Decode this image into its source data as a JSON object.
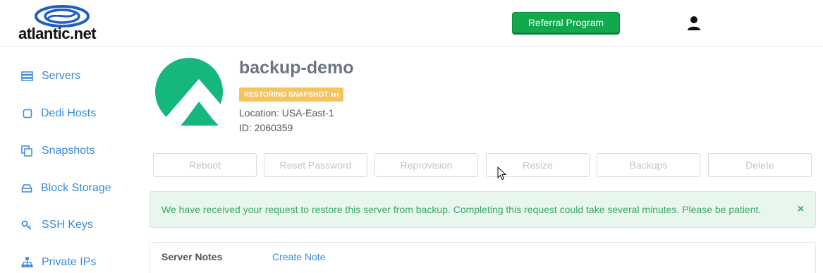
{
  "header": {
    "logo_text": "atlantic.net",
    "referral_label": "Referral Program",
    "colors": {
      "referral": "#10a94b",
      "logo_blue": "#1f5fbf"
    }
  },
  "sidebar": {
    "items": [
      {
        "label": "Servers",
        "icon": "server-icon"
      },
      {
        "label": "Dedi Hosts",
        "icon": "square-icon"
      },
      {
        "label": "Snapshots",
        "icon": "copy-icon"
      },
      {
        "label": "Block Storage",
        "icon": "drive-icon"
      },
      {
        "label": "SSH Keys",
        "icon": "key-icon"
      },
      {
        "label": "Private IPs",
        "icon": "network-icon"
      }
    ],
    "link_color": "#3a8ad6"
  },
  "server": {
    "name": "backup-demo",
    "status": "RESTORING SNAPSHOT",
    "location": "Location: USA-East-1",
    "id": "ID: 2060359",
    "avatar_color": "#16b77c",
    "status_color": "#f7c35c"
  },
  "actions": [
    {
      "label": "Reboot"
    },
    {
      "label": "Reset Password"
    },
    {
      "label": "Reprovision"
    },
    {
      "label": "Resize"
    },
    {
      "label": "Backups"
    },
    {
      "label": "Delete"
    }
  ],
  "alert": {
    "message": "We have received your request to restore this server from backup. Completing this request could take several minutes. Please be patient.",
    "close": "×"
  },
  "notes": {
    "title": "Server Notes",
    "create_label": "Create Note"
  }
}
